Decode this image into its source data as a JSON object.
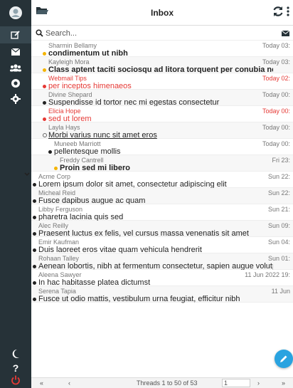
{
  "header": {
    "title": "Inbox"
  },
  "search": {
    "placeholder": "Search..."
  },
  "messages": [
    {
      "from": "Sharmin Bellamy",
      "date": "Today 03:",
      "subject": "condimentum ut nibh",
      "tail": "",
      "marker": "star",
      "unread": true,
      "flagged": false
    },
    {
      "from": "Kayleigh Mora",
      "date": "Today 03:",
      "subject": "Class aptent taciti sociosqu ad litora torquent per conubia nostra",
      "tail": "",
      "marker": "star",
      "unread": true,
      "flagged": false
    },
    {
      "from": "Webmail Tips",
      "date": "Today 02:",
      "subject": "per inceptos himenaeos",
      "tail": "",
      "marker": "dot",
      "unread": false,
      "flagged": true
    },
    {
      "from": "Divine Shepard",
      "date": "Today 00:",
      "subject": "Suspendisse id tortor nec mi egestas consectetur",
      "tail": "",
      "marker": "dot",
      "unread": false,
      "flagged": false
    },
    {
      "from": "Elicia Hope",
      "date": "Today 00:",
      "subject": "sed ut lorem",
      "tail": "",
      "marker": "dot",
      "unread": false,
      "flagged": true
    },
    {
      "from": "Layla Hays",
      "date": "Today 00:",
      "subject": "Morbi varius nunc sit amet eros",
      "tail": "",
      "marker": "ring",
      "unread": false,
      "flagged": false
    },
    {
      "from": "Muneeb Marriott",
      "date": "Today 00:",
      "subject": "pellentesque mollis",
      "tail": "",
      "marker": "dot",
      "unread": false,
      "flagged": false
    },
    {
      "from": "Freddy Cantrell",
      "date": "Fri 23:",
      "subject": "Proin sed mi libero",
      "tail": "",
      "marker": "star",
      "unread": true,
      "flagged": false
    },
    {
      "from": "Acme Corp",
      "date": "Sun 22:",
      "subject": "Lorem ipsum dolor sit amet, consectetur adipiscing elit",
      "tail": "",
      "marker": "dot",
      "unread": false,
      "flagged": false
    },
    {
      "from": "Micheal Reid",
      "date": "Sun 22:",
      "subject": "Fusce dapibus augue ac quam",
      "tail": "",
      "marker": "dot",
      "unread": false,
      "flagged": false
    },
    {
      "from": "Libby Ferguson",
      "date": "Sun 21:",
      "subject": "pharetra lacinia quis sed",
      "tail": "",
      "marker": "dot",
      "unread": false,
      "flagged": false
    },
    {
      "from": "Alec Reilly",
      "date": "Sun 09:",
      "subject": "Praesent luctus ex felis, vel cursus massa venenatis sit amet",
      "tail": "",
      "marker": "dot",
      "unread": false,
      "flagged": false
    },
    {
      "from": "Emir Kaufman",
      "date": "Sun 04:",
      "subject": "Duis laoreet eros vitae quam vehicula hendrerit",
      "tail": "",
      "marker": "dot",
      "unread": false,
      "flagged": false
    },
    {
      "from": "Rohaan Talley",
      "date": "Sun 01:",
      "subject": "Aenean lobortis, nibh at fermentum consectetur, sapien augue volutpat libero, in feugiat diam ex ac lo...",
      "tail": "",
      "marker": "dot",
      "unread": false,
      "flagged": false
    },
    {
      "from": "Aleena Sawyer",
      "date": "11 Jun 2022 19:",
      "subject": "In hac habitasse platea dictumst",
      "tail": "",
      "marker": "dot",
      "unread": false,
      "flagged": false
    },
    {
      "from": "Serena Tapia",
      "date": "11 Jun",
      "subject": "Fusce ut odio mattis, vestibulum urna feugiat, efficitur nibh",
      "tail": "",
      "marker": "dot",
      "unread": false,
      "flagged": false
    }
  ],
  "pager": {
    "first": "«",
    "prev": "‹",
    "info": "Threads 1 to 50 of 53",
    "page": "1",
    "next": "›",
    "last": "»"
  },
  "colors": {
    "rail": "#263238",
    "accent": "#29a3e0",
    "flag": "#e53935",
    "star": "#f4b400"
  },
  "rail_icons": [
    "user-avatar-icon",
    "compose-icon",
    "inbox-icon",
    "contacts-icon",
    "help-ring-icon",
    "settings-icon",
    "dark-mode-icon",
    "help-icon",
    "logout-icon"
  ]
}
